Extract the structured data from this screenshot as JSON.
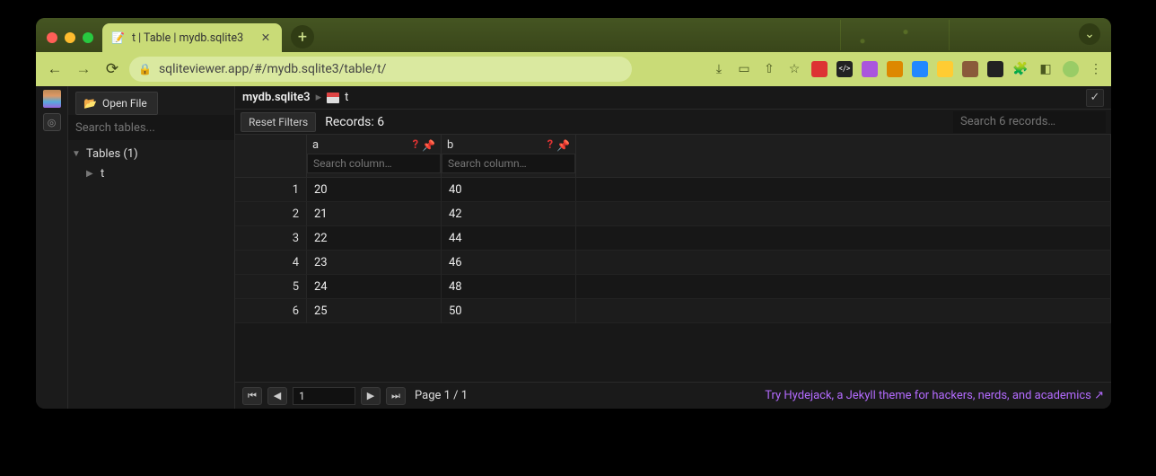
{
  "browser": {
    "tab_title": "t | Table | mydb.sqlite3",
    "url": "sqliteviewer.app/#/mydb.sqlite3/table/t/"
  },
  "sidebar": {
    "open_file_label": "Open File",
    "search_placeholder": "Search tables...",
    "tree": {
      "tables_label": "Tables (1)",
      "items": [
        "t"
      ]
    }
  },
  "breadcrumb": {
    "db": "mydb.sqlite3",
    "table": "t"
  },
  "filters": {
    "reset_label": "Reset Filters",
    "records_label": "Records: 6",
    "search_placeholder": "Search 6 records…"
  },
  "columns": [
    {
      "name": "a",
      "search_placeholder": "Search column…"
    },
    {
      "name": "b",
      "search_placeholder": "Search column…"
    }
  ],
  "rows": [
    {
      "n": "1",
      "a": "20",
      "b": "40"
    },
    {
      "n": "2",
      "a": "21",
      "b": "42"
    },
    {
      "n": "3",
      "a": "22",
      "b": "44"
    },
    {
      "n": "4",
      "a": "23",
      "b": "46"
    },
    {
      "n": "5",
      "a": "24",
      "b": "48"
    },
    {
      "n": "6",
      "a": "25",
      "b": "50"
    }
  ],
  "pagination": {
    "current": "1",
    "label": "Page 1 / 1"
  },
  "footer_promo": "Try Hydejack, a Jekyll theme for hackers, nerds, and academics ↗"
}
